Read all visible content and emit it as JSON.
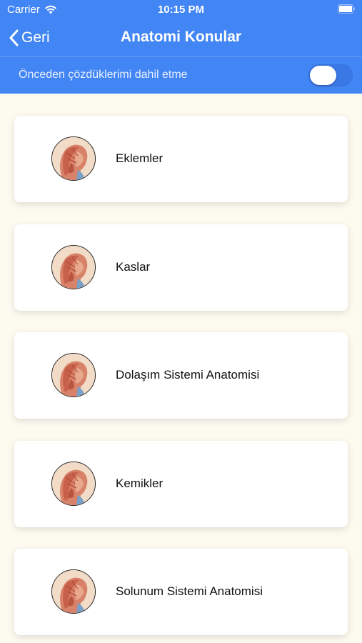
{
  "status_bar": {
    "carrier": "Carrier",
    "time": "10:15 PM"
  },
  "nav": {
    "back_label": "Geri",
    "title": "Anatomi Konular"
  },
  "filter": {
    "label": "Önceden çözdüklerimi dahil etme",
    "toggle_on": false
  },
  "topics": [
    {
      "label": "Eklemler",
      "icon": "head-anatomy-icon"
    },
    {
      "label": "Kaslar",
      "icon": "head-anatomy-icon"
    },
    {
      "label": "Dolaşım Sistemi Anatomisi",
      "icon": "head-anatomy-icon"
    },
    {
      "label": "Kemikler",
      "icon": "head-anatomy-icon"
    },
    {
      "label": "Solunum Sistemi Anatomisi",
      "icon": "head-anatomy-icon"
    }
  ],
  "colors": {
    "header": "#4285f4",
    "background": "#fdfbf0",
    "card": "#ffffff"
  }
}
